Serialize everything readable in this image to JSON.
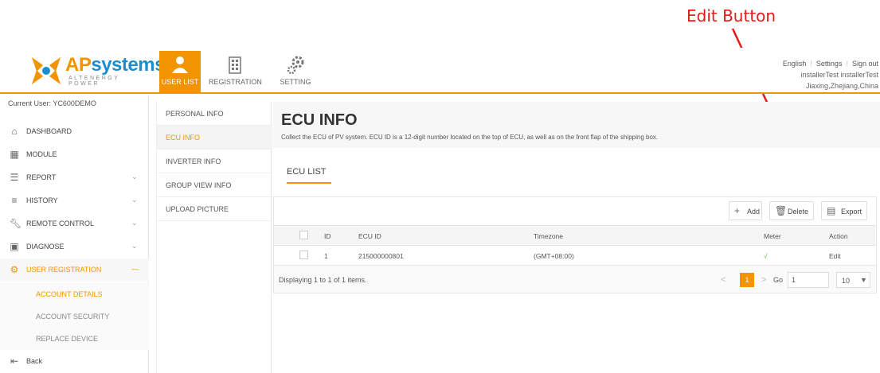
{
  "annotation": {
    "label": "Edit Button"
  },
  "brand": {
    "name_ap": "AP",
    "name_rest": "systems",
    "tagline": "ALTENERGY POWER"
  },
  "nav": {
    "tabs": [
      {
        "label": "USER LIST",
        "icon": "users-icon",
        "active": true
      },
      {
        "label": "REGISTRATION",
        "icon": "building-icon",
        "active": false
      },
      {
        "label": "SETTING",
        "icon": "gears-icon",
        "active": false
      }
    ]
  },
  "top_links": {
    "language": "English",
    "settings": "Settings",
    "signout": "Sign out"
  },
  "user_info": {
    "name": "installerTest installerTest",
    "location": "Jiaxing,Zhejiang,China"
  },
  "sidebar": {
    "current_user": "Current User: YC600DEMO",
    "items": [
      {
        "label": "DASHBOARD",
        "icon": "home-icon",
        "has_chevron": false
      },
      {
        "label": "MODULE",
        "icon": "grid-icon",
        "has_chevron": false
      },
      {
        "label": "REPORT",
        "icon": "report-icon",
        "has_chevron": true
      },
      {
        "label": "HISTORY",
        "icon": "database-icon",
        "has_chevron": true
      },
      {
        "label": "REMOTE CONTROL",
        "icon": "wrench-icon",
        "has_chevron": true
      },
      {
        "label": "DIAGNOSE",
        "icon": "diagnose-icon",
        "has_chevron": true
      },
      {
        "label": "USER REGISTRATION",
        "icon": "gears-icon",
        "has_chevron": true,
        "active": true
      }
    ],
    "sub_items": [
      {
        "label": "ACCOUNT DETAILS",
        "active": true
      },
      {
        "label": "ACCOUNT SECURITY",
        "active": false
      },
      {
        "label": "REPLACE DEVICE",
        "active": false
      }
    ],
    "back": "Back"
  },
  "submenu": {
    "items": [
      {
        "label": "PERSONAL INFO",
        "active": false
      },
      {
        "label": "ECU INFO",
        "active": true
      },
      {
        "label": "INVERTER INFO",
        "active": false
      },
      {
        "label": "GROUP VIEW INFO",
        "active": false
      },
      {
        "label": "UPLOAD PICTURE",
        "active": false
      }
    ]
  },
  "main": {
    "title": "ECU INFO",
    "description": "Collect the ECU of PV system. ECU ID is a 12-digit number located on the top of ECU, as well as on the front flap of the shipping box.",
    "section_title": "ECU LIST",
    "toolbar": {
      "add": "Add",
      "delete": "Delete",
      "export": "Export"
    },
    "table": {
      "columns": {
        "id": "ID",
        "ecu_id": "ECU ID",
        "timezone": "Timezone",
        "meter": "Meter",
        "action": "Action"
      },
      "rows": [
        {
          "id": "1",
          "ecu_id": "215000000801",
          "timezone": "(GMT+08:00)",
          "meter": "√",
          "action": "Edit"
        }
      ]
    },
    "pager": {
      "summary": "Displaying 1 to 1 of 1 items.",
      "page": "1",
      "go_label": "Go",
      "go_value": "1",
      "page_size": "10"
    }
  }
}
